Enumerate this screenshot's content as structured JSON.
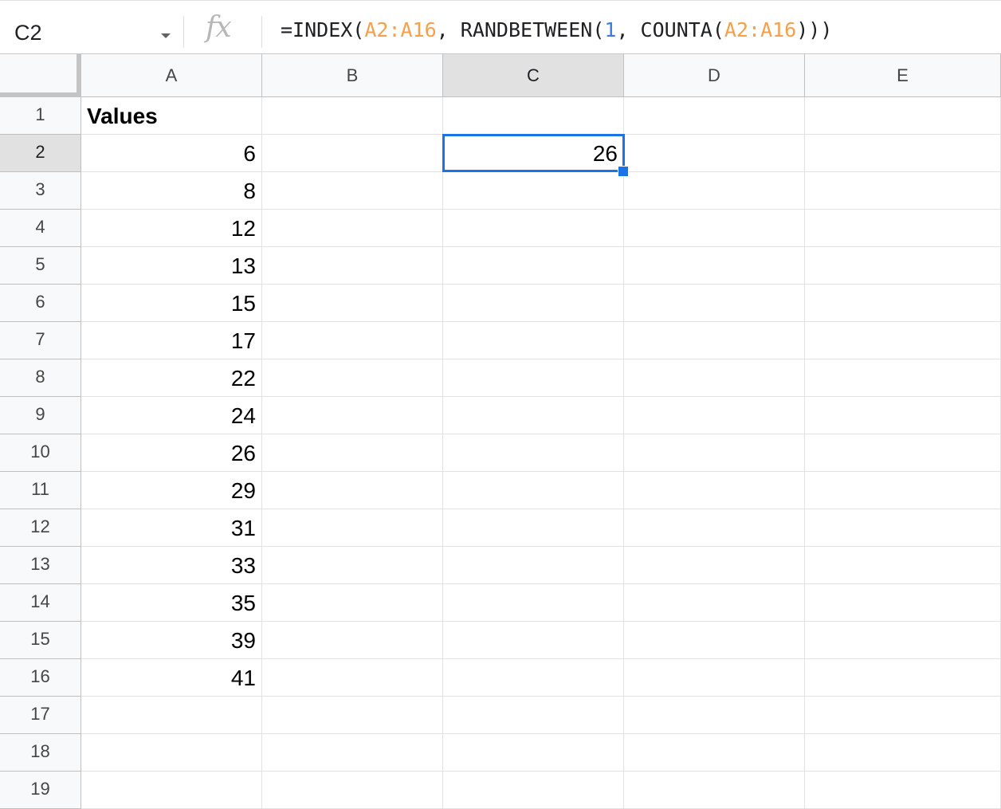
{
  "formula_bar": {
    "name_box": "C2",
    "fx_label": "fx",
    "formula": {
      "prefix": "=INDEX(",
      "range1": "A2:A16",
      "mid1": ", RANDBETWEEN(",
      "num": "1",
      "mid2": ", COUNTA(",
      "range2": "A2:A16",
      "suffix": ")))"
    }
  },
  "grid": {
    "columns": [
      "A",
      "B",
      "C",
      "D",
      "E"
    ],
    "rows": [
      "1",
      "2",
      "3",
      "4",
      "5",
      "6",
      "7",
      "8",
      "9",
      "10",
      "11",
      "12",
      "13",
      "14",
      "15",
      "16",
      "17",
      "18",
      "19"
    ],
    "active_cell": "C2",
    "column_a": [
      "Values",
      "6",
      "8",
      "12",
      "13",
      "15",
      "17",
      "22",
      "24",
      "26",
      "29",
      "31",
      "33",
      "35",
      "39",
      "41"
    ],
    "c2_value": "26"
  },
  "colors": {
    "selection": "#1a73e8",
    "formula_range": "#f4a04d",
    "formula_number": "#3b7ddd"
  }
}
